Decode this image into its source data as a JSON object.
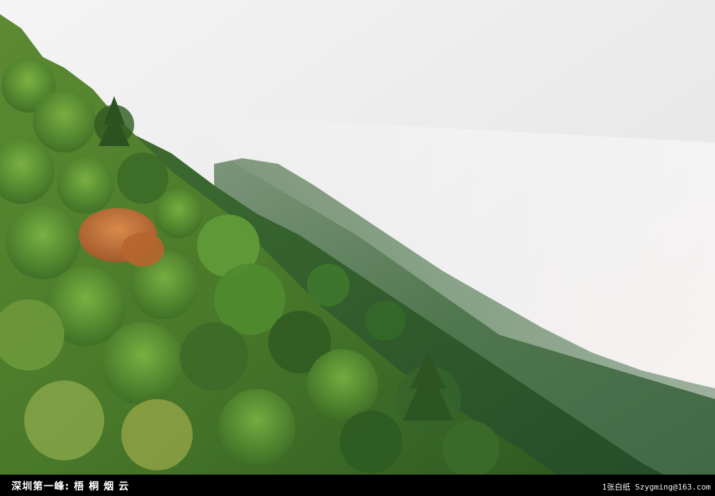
{
  "caption": {
    "title": "深圳第一峰: 梧 桐 烟 云",
    "credit": "1张白纸 Szygming@163.com"
  },
  "colors": {
    "caption_background": "#000000",
    "caption_text": "#ffffff",
    "mist": "#ececec",
    "near_forest": "#4f7f2c",
    "far_ridge": "#3f6a3d",
    "autumn_tree": "#c8703a"
  }
}
